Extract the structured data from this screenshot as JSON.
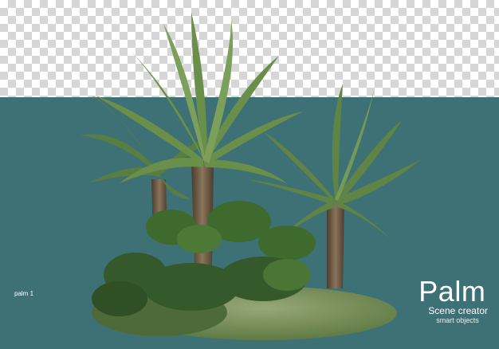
{
  "image": {
    "caption_label": "palm 1",
    "title": "Palm",
    "subtitle": "Scene creator",
    "tagline": "smart objects"
  },
  "colors": {
    "background_teal": "#3e7176",
    "palm_frond": "#4f7a3a",
    "palm_trunk": "#6d5b45",
    "grass": "#6e8a52",
    "shrub": "#3f6a2d"
  }
}
